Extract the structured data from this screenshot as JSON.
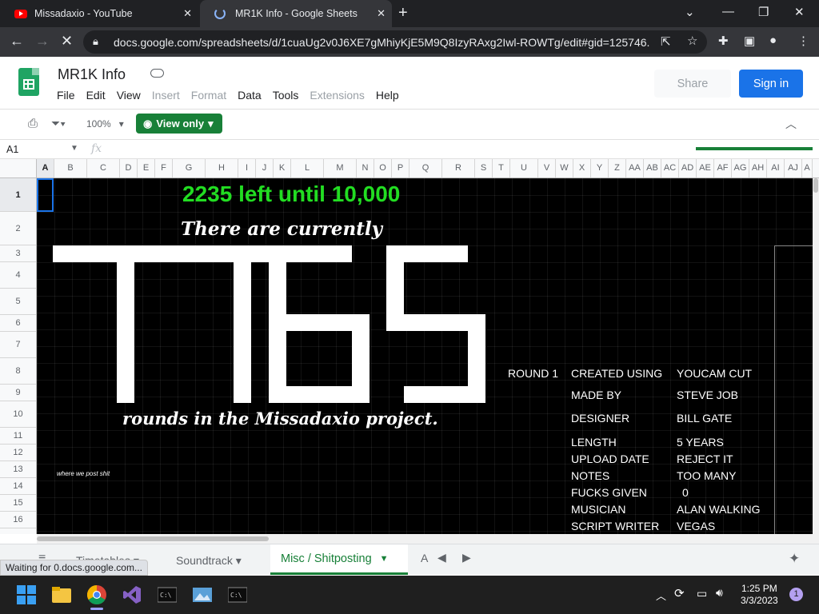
{
  "browser": {
    "tabs": [
      {
        "title": "Missadaxio - YouTube",
        "active": false
      },
      {
        "title": "MR1K Info - Google Sheets",
        "active": true
      }
    ],
    "url": "docs.google.com/spreadsheets/d/1cuaUg2v0J6XE7gMhiyKjE5M9Q8IzyRAxg2Iwl-ROWTg/edit#gid=125746...",
    "status_text": "Waiting for 0.docs.google.com..."
  },
  "sheets": {
    "doc_title": "MR1K Info",
    "menus": [
      {
        "label": "File",
        "enabled": true
      },
      {
        "label": "Edit",
        "enabled": true
      },
      {
        "label": "View",
        "enabled": true
      },
      {
        "label": "Insert",
        "enabled": false
      },
      {
        "label": "Format",
        "enabled": false
      },
      {
        "label": "Data",
        "enabled": true
      },
      {
        "label": "Tools",
        "enabled": true
      },
      {
        "label": "Extensions",
        "enabled": false
      },
      {
        "label": "Help",
        "enabled": true
      }
    ],
    "share_label": "Share",
    "signin_label": "Sign in",
    "zoom": "100%",
    "view_mode": "View only",
    "name_box": "A1",
    "fx": "fx",
    "columns": [
      "A",
      "B",
      "C",
      "D",
      "E",
      "F",
      "G",
      "H",
      "I",
      "J",
      "K",
      "L",
      "M",
      "N",
      "O",
      "P",
      "Q",
      "R",
      "S",
      "T",
      "U",
      "V",
      "W",
      "X",
      "Y",
      "Z",
      "AA",
      "AB",
      "AC",
      "AD",
      "AE",
      "AF",
      "AG",
      "AH",
      "AI",
      "AJ",
      "A"
    ],
    "rows": [
      "1",
      "2",
      "3",
      "4",
      "5",
      "6",
      "7",
      "8",
      "9",
      "10",
      "11",
      "12",
      "13",
      "14",
      "15",
      "16"
    ]
  },
  "content": {
    "headline": "2235 left until 10,000",
    "line1": "There are currently",
    "big_number": "1765",
    "line2": "rounds in the Missadaxio project.",
    "small_note": "where we post shit",
    "round_label": "ROUND 1",
    "info_rows": [
      {
        "key": "CREATED USING",
        "value": "YOUCAM CUT"
      },
      {
        "key": "MADE BY",
        "value": "STEVE JOB"
      },
      {
        "key": "DESIGNER",
        "value": "BILL GATE"
      },
      {
        "key": "LENGTH",
        "value": "5 YEARS"
      },
      {
        "key": "UPLOAD DATE",
        "value": "REJECT IT"
      },
      {
        "key": "NOTES",
        "value": "TOO MANY"
      },
      {
        "key": "FUCKS GIVEN",
        "value": "0"
      },
      {
        "key": "MUSICIAN",
        "value": "ALAN WALKING"
      },
      {
        "key": "SCRIPT WRITER",
        "value": "VEGAS"
      }
    ]
  },
  "sheet_tabs": {
    "tabs": [
      "Timetables",
      "Soundtrack",
      "Misc / Shitposting",
      "A"
    ],
    "active": "Misc / Shitposting"
  },
  "taskbar": {
    "time": "1:25 PM",
    "date": "3/3/2023",
    "notification_count": "1"
  },
  "colors": {
    "headline": "#22dd22",
    "sheets_green": "#188038",
    "signin_blue": "#1a73e8",
    "grid_bg": "#000000"
  }
}
